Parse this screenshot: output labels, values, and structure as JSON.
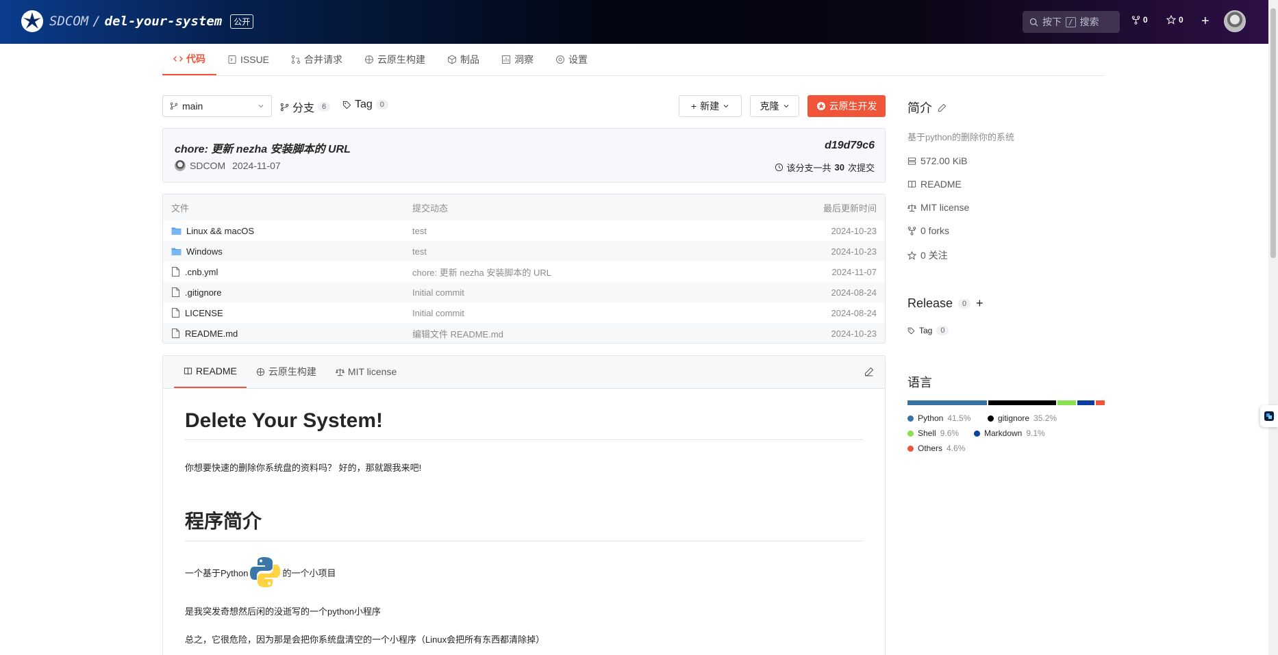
{
  "header": {
    "org": "SDCOM",
    "separator": "/",
    "repo": "del-your-system",
    "visibility": "公开",
    "search_press": "按下",
    "search_key": "/",
    "search_label": "搜索",
    "forks_count": "0",
    "stars_count": "0"
  },
  "nav": {
    "tabs": [
      {
        "label": "代码",
        "icon": "code-icon"
      },
      {
        "label": "ISSUE",
        "icon": "issue-icon"
      },
      {
        "label": "合并请求",
        "icon": "pull-request-icon"
      },
      {
        "label": "云原生构建",
        "icon": "build-icon"
      },
      {
        "label": "制品",
        "icon": "package-icon"
      },
      {
        "label": "洞察",
        "icon": "insights-icon"
      },
      {
        "label": "设置",
        "icon": "settings-icon"
      }
    ]
  },
  "toolbar": {
    "branch": "main",
    "branches_label": "分支",
    "branches_count": "6",
    "tags_label": "Tag",
    "tags_count": "0",
    "new_label": "新建",
    "clone_label": "克隆",
    "dev_label": "云原生开发"
  },
  "commit": {
    "message": "chore: 更新 nezha 安装脚本的 URL",
    "hash": "d19d79c6",
    "author": "SDCOM",
    "date": "2024-11-07",
    "count_prefix": "该分支一共",
    "count": "30",
    "count_suffix": "次提交"
  },
  "files": {
    "headers": [
      "文件",
      "提交动态",
      "最后更新时间"
    ],
    "rows": [
      {
        "name": "Linux && macOS",
        "type": "folder",
        "message": "test",
        "date": "2024-10-23"
      },
      {
        "name": "Windows",
        "type": "folder",
        "message": "test",
        "date": "2024-10-23"
      },
      {
        "name": ".cnb.yml",
        "type": "file",
        "message": "chore: 更新 nezha 安装脚本的 URL",
        "date": "2024-11-07"
      },
      {
        "name": ".gitignore",
        "type": "file",
        "message": "Initial commit",
        "date": "2024-08-24"
      },
      {
        "name": "LICENSE",
        "type": "file",
        "message": "Initial commit",
        "date": "2024-08-24"
      },
      {
        "name": "README.md",
        "type": "file",
        "message": "编辑文件 README.md",
        "date": "2024-10-23"
      }
    ]
  },
  "readme": {
    "tabs": [
      "README",
      "云原生构建",
      "MIT license"
    ],
    "h1": "Delete Your System!",
    "p1": "你想要快速的删除你系统盘的资料吗？ 好的，那就跟我来吧!",
    "h2": "程序简介",
    "p2_before": "一个基于Python",
    "p2_after": "的一个小项目",
    "p3": "是我突发奇想然后闲的没逝写的一个python小程序",
    "p4": "总之，它很危险，因为那是会把你系统盘清空的一个小程序（Linux会把所有东西都清除掉）"
  },
  "sidebar": {
    "about_title": "简介",
    "description": "基于python的删除你的系统",
    "size": "572.00 KiB",
    "readme": "README",
    "license": "MIT license",
    "forks": "0 forks",
    "watch": "0 关注",
    "release_title": "Release",
    "release_count": "0",
    "tag_label": "Tag",
    "tag_count": "0",
    "lang_title": "语言",
    "languages": [
      {
        "name": "Python",
        "pct": "41.5%",
        "color": "#3572A5"
      },
      {
        "name": "gitignore",
        "pct": "35.2%",
        "color": "#000000"
      },
      {
        "name": "Shell",
        "pct": "9.6%",
        "color": "#89e051"
      },
      {
        "name": "Markdown",
        "pct": "9.1%",
        "color": "#083fa1"
      },
      {
        "name": "Others",
        "pct": "4.6%",
        "color": "#f0553a"
      }
    ]
  },
  "colors": {
    "accent": "#f0553a"
  }
}
